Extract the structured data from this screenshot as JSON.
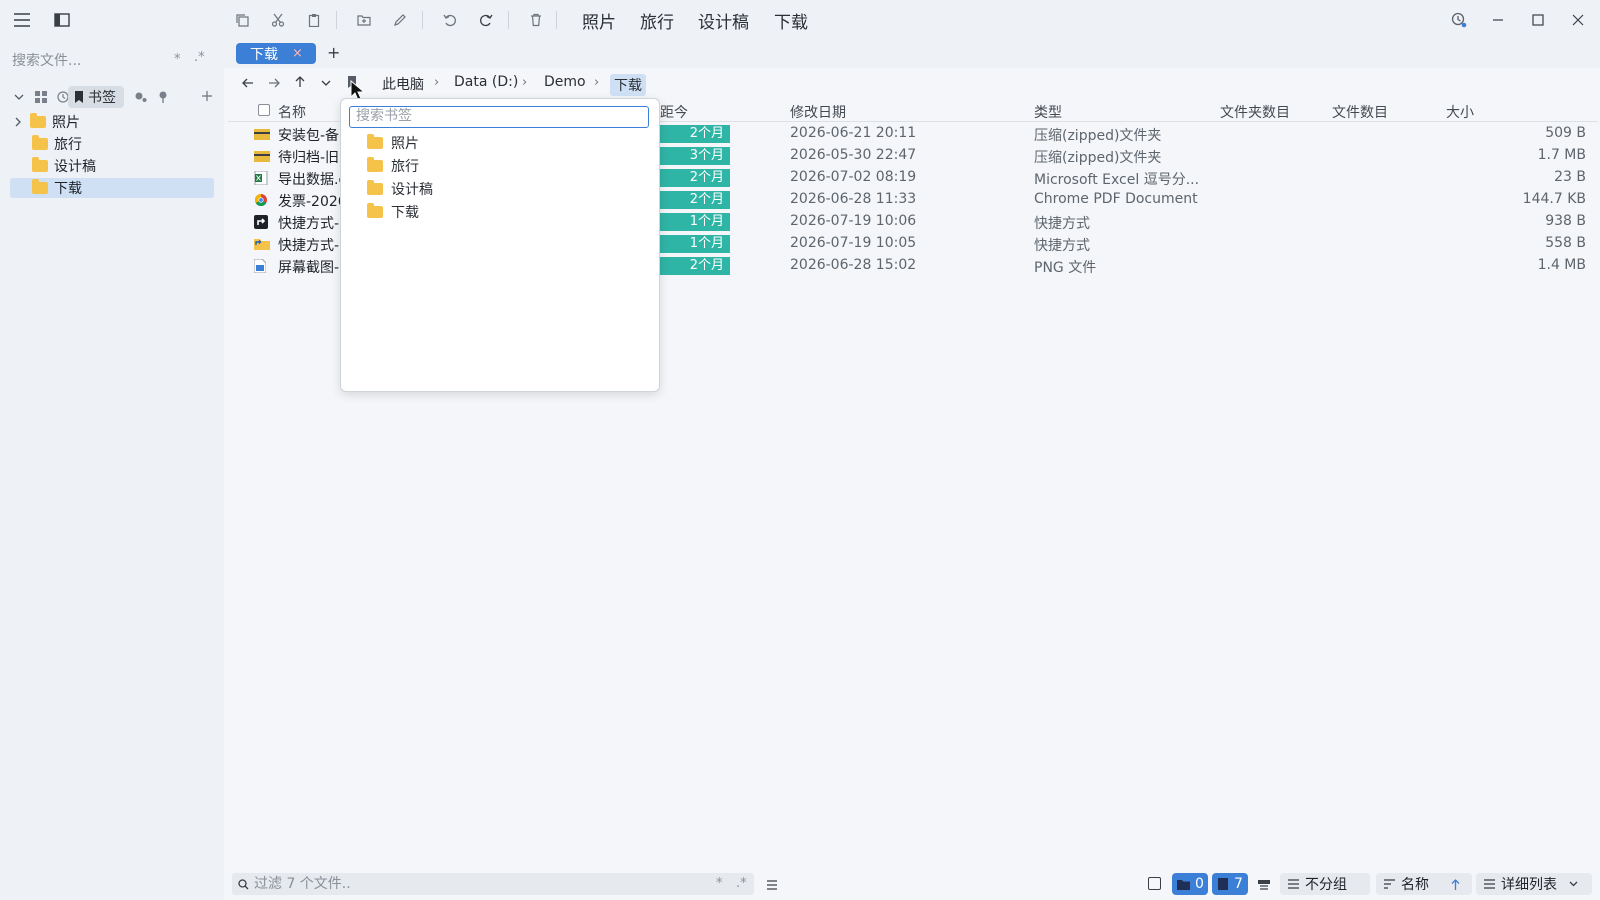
{
  "toolbar": {
    "favorites": [
      "照片",
      "旅行",
      "设计稿",
      "下载"
    ]
  },
  "sidebar": {
    "search_placeholder": "搜索文件...",
    "search_star": "*",
    "search_regex": ".*",
    "active_tab_label": "书签",
    "items": [
      {
        "label": "照片",
        "expandable": true
      },
      {
        "label": "旅行",
        "expandable": false
      },
      {
        "label": "设计稿",
        "expandable": false
      },
      {
        "label": "下载",
        "expandable": false,
        "selected": true
      }
    ]
  },
  "tabs": {
    "active_label": "下载",
    "close_symbol": "×",
    "add_symbol": "+"
  },
  "breadcrumb": {
    "items": [
      "此电脑",
      "Data (D:)",
      "Demo",
      "下载"
    ],
    "separator": "›"
  },
  "columns": {
    "name": "名称",
    "age": "距今",
    "modified": "修改日期",
    "type": "类型",
    "folder_count": "文件夹数目",
    "file_count": "文件数目",
    "size": "大小"
  },
  "files": [
    {
      "name": "安装包-备",
      "age": "2个月",
      "modified": "2026-06-21 20:11",
      "type": "压缩(zipped)文件夹",
      "size": "509 B",
      "icon": "zip-icon"
    },
    {
      "name": "待归档-旧",
      "age": "3个月",
      "modified": "2026-05-30 22:47",
      "type": "压缩(zipped)文件夹",
      "size": "1.7 MB",
      "icon": "zip-icon"
    },
    {
      "name": "导出数据.c",
      "age": "2个月",
      "modified": "2026-07-02 08:19",
      "type": "Microsoft Excel 逗号分...",
      "size": "23 B",
      "icon": "excel-icon"
    },
    {
      "name": "发票-2026",
      "age": "2个月",
      "modified": "2026-06-28 11:33",
      "type": "Chrome PDF Document",
      "size": "144.7 KB",
      "icon": "chrome-icon"
    },
    {
      "name": "快捷方式-",
      "age": "1个月",
      "modified": "2026-07-19 10:06",
      "type": "快捷方式",
      "size": "938 B",
      "icon": "shortcut-icon"
    },
    {
      "name": "快捷方式-",
      "age": "1个月",
      "modified": "2026-07-19 10:05",
      "type": "快捷方式",
      "size": "558 B",
      "icon": "shortcut-folder-icon"
    },
    {
      "name": "屏幕截图-",
      "age": "2个月",
      "modified": "2026-06-28 15:02",
      "type": "PNG 文件",
      "size": "1.4 MB",
      "icon": "image-icon"
    }
  ],
  "bookmark_dropdown": {
    "search_placeholder": "搜索书签",
    "items": [
      "照片",
      "旅行",
      "设计稿",
      "下载"
    ]
  },
  "statusbar": {
    "filter_placeholder": "过滤 7 个文件..",
    "filter_star": "*",
    "filter_regex": ".*",
    "folder_count": "0",
    "file_count": "7",
    "group_label": "不分组",
    "sort_label": "名称",
    "view_label": "详细列表"
  },
  "colors": {
    "accent": "#3b7fd6",
    "age_badge": "#2fb5a6",
    "selection": "#cfe0f5"
  }
}
